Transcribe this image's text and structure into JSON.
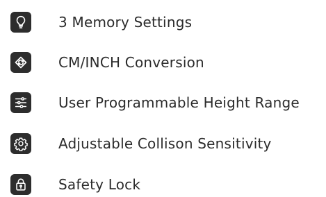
{
  "features": [
    {
      "label": "3 Memory Settings",
      "icon": "lightbulb-icon"
    },
    {
      "label": "CM/INCH Conversion",
      "icon": "refresh-arrows-icon"
    },
    {
      "label": "User Programmable Height Range",
      "icon": "sliders-icon"
    },
    {
      "label": "Adjustable Collison Sensitivity",
      "icon": "gear-icon"
    },
    {
      "label": "Safety Lock",
      "icon": "padlock-icon"
    }
  ],
  "colors": {
    "icon_background": "#2d2d2d",
    "icon_stroke": "#ffffff",
    "text": "#2b2b2b",
    "page_background": "#ffffff"
  }
}
